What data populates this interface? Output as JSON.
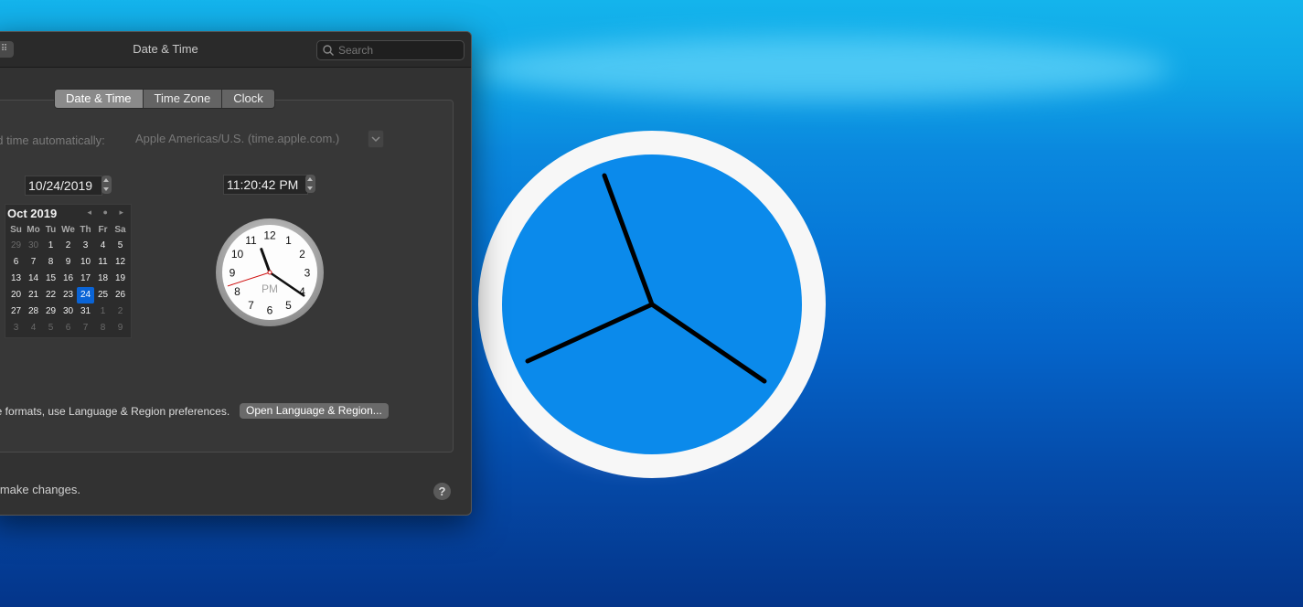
{
  "window": {
    "title": "Date & Time",
    "grid_icon": "grid-icon",
    "search_placeholder": "Search"
  },
  "tabs": [
    {
      "label": "Date & Time",
      "active": true
    },
    {
      "label": "Time Zone",
      "active": false
    },
    {
      "label": "Clock",
      "active": false
    }
  ],
  "auto": {
    "label": "nd time automatically:",
    "server": "Apple Americas/U.S. (time.apple.com.)"
  },
  "date_value": "10/24/2019",
  "time_value": "11:20:42 PM",
  "calendar": {
    "month_label": "Oct 2019",
    "nav": "◂ ● ▸",
    "weekdays": [
      "Su",
      "Mo",
      "Tu",
      "We",
      "Th",
      "Fr",
      "Sa"
    ],
    "days": [
      [
        "29",
        "30",
        "1",
        "2",
        "3",
        "4",
        "5"
      ],
      [
        "6",
        "7",
        "8",
        "9",
        "10",
        "11",
        "12"
      ],
      [
        "13",
        "14",
        "15",
        "16",
        "17",
        "18",
        "19"
      ],
      [
        "20",
        "21",
        "22",
        "23",
        "24",
        "25",
        "26"
      ],
      [
        "27",
        "28",
        "29",
        "30",
        "31",
        "1",
        "2"
      ],
      [
        "3",
        "4",
        "5",
        "6",
        "7",
        "8",
        "9"
      ]
    ],
    "selected": "24"
  },
  "clock": {
    "numbers": [
      "12",
      "1",
      "2",
      "3",
      "4",
      "5",
      "6",
      "7",
      "8",
      "9",
      "10",
      "11"
    ],
    "meridiem": "PM",
    "time": {
      "hours": 11,
      "minutes": 20,
      "seconds": 42
    }
  },
  "footer": {
    "lang_text": "ne formats, use Language & Region preferences.",
    "lang_button": "Open Language & Region...",
    "lock_text": "o make changes.",
    "help_label": "?"
  },
  "colors": {
    "accent": "#0a64d6",
    "second_hand": "#d01010"
  }
}
